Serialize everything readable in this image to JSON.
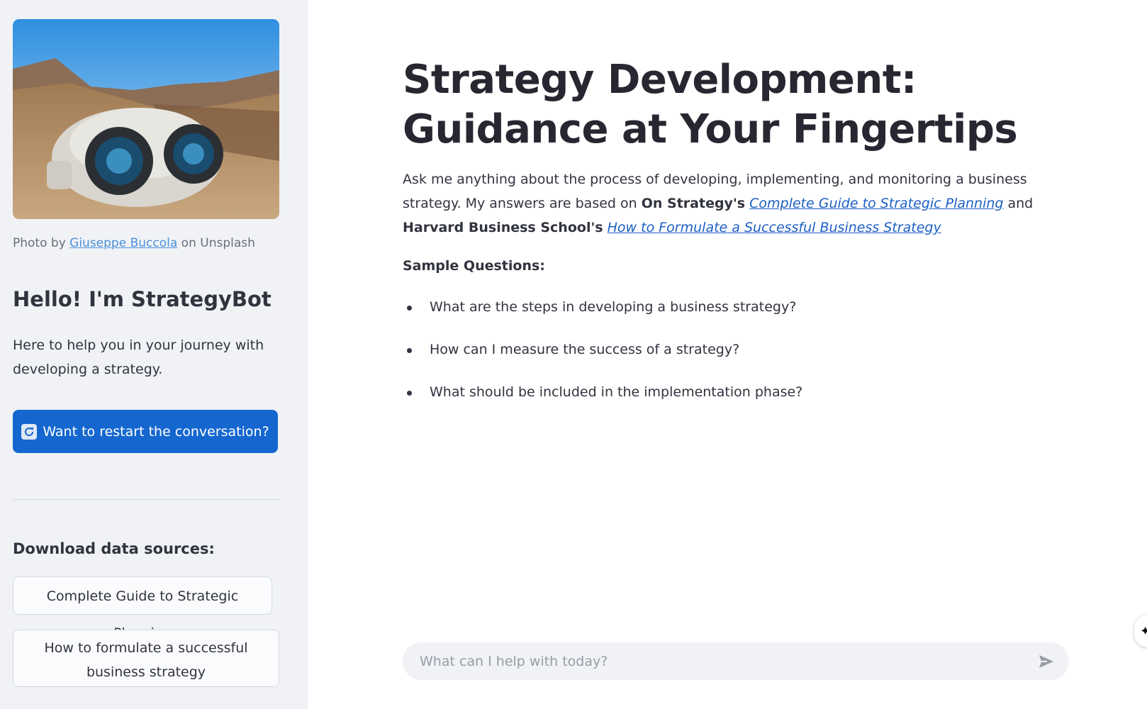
{
  "sidebar": {
    "photo_credit": {
      "prefix": "Photo by",
      "author": "Giuseppe Buccola",
      "suffix": "on Unsplash"
    },
    "greeting": "Hello! I'm StrategyBot",
    "intro": "Here to help you in your journey with developing a strategy.",
    "restart_button": "Want to restart the conversation?",
    "restart_icon": "refresh-icon",
    "download_title": "Download data sources:",
    "download_buttons": [
      "Complete Guide to Strategic Planning",
      "How to formulate a successful business strategy"
    ]
  },
  "main": {
    "title": "Strategy Development: Guidance at Your Fingertips",
    "description": {
      "line1": "Ask me anything about the process of developing, implementing, and monitoring a business strategy. My answers are based on",
      "source1_org": "On Strategy's",
      "source1_title": "Complete Guide to Strategic Planning",
      "conj": "and",
      "source2_org": "Harvard Business School's",
      "source2_title": "How to Formulate a Successful Business Strategy"
    },
    "sample_label": "Sample Questions:",
    "questions": [
      "What are the steps in developing a business strategy?",
      "How can I measure the success of a strategy?",
      "What should be included in the implementation phase?"
    ]
  },
  "chat": {
    "placeholder": "What can I help with today?",
    "send_icon": "send-icon"
  },
  "colors": {
    "sidebar_bg": "#f0f2f6",
    "primary_button": "#1567cf",
    "link": "#1c5fc4"
  }
}
